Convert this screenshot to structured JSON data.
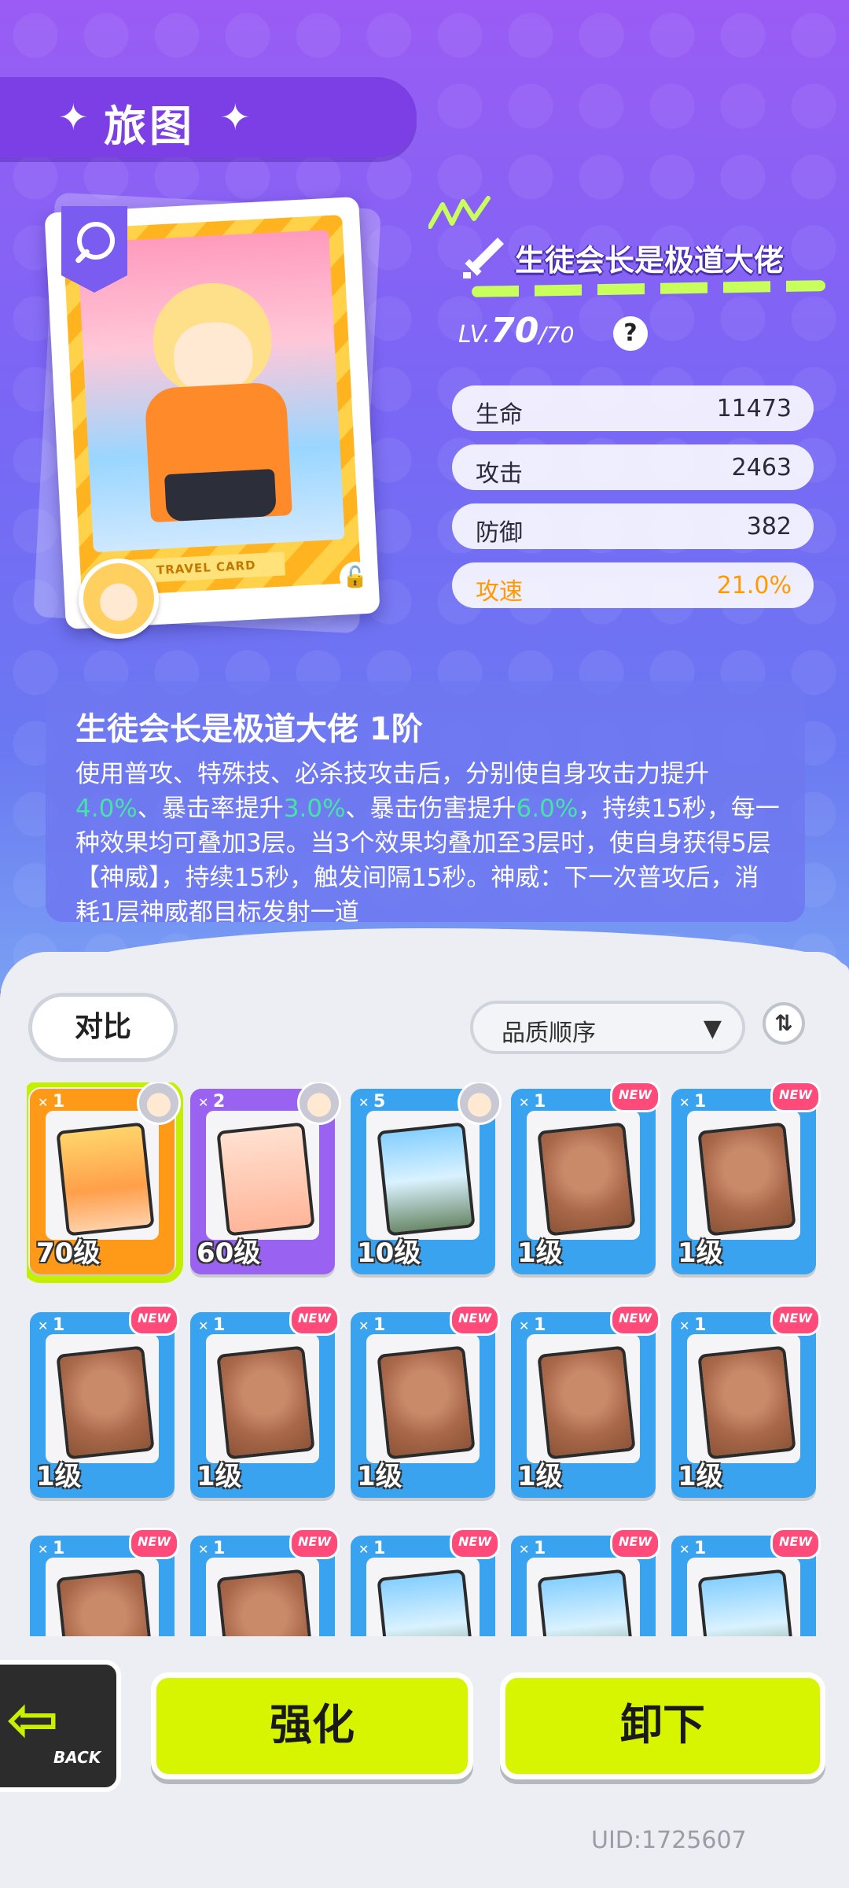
{
  "header": {
    "title": "旅图"
  },
  "card": {
    "label": "TRAVEL CARD",
    "name": "生徒会长是极道大佬",
    "level_prefix": "LV.",
    "level_current": "70",
    "level_max": "/70",
    "stats": [
      {
        "label": "生命",
        "value": "11473",
        "highlight": false
      },
      {
        "label": "攻击",
        "value": "2463",
        "highlight": false
      },
      {
        "label": "防御",
        "value": "382",
        "highlight": false
      },
      {
        "label": "攻速",
        "value": "21.0%",
        "highlight": true
      }
    ]
  },
  "skill": {
    "title": "生徒会长是极道大佬 1阶",
    "desc_parts": [
      {
        "text": "使用普攻、特殊技、必杀技攻击后，分别使自身攻击力提升",
        "green": false
      },
      {
        "text": "4.0%",
        "green": true
      },
      {
        "text": "、暴击率提升",
        "green": false
      },
      {
        "text": "3.0%",
        "green": true
      },
      {
        "text": "、暴击伤害提升",
        "green": false
      },
      {
        "text": "6.0%",
        "green": true
      },
      {
        "text": "，持续15秒，每一种效果均可叠加3层。当3个效果均叠加至3层时，使自身获得5层【神威】，持续15秒，触发间隔15秒。神威：下一次普攻后，消耗1层神威都目标发射一道",
        "green": false
      }
    ]
  },
  "controls": {
    "compare_label": "对比",
    "sort_label": "品质顺序",
    "sort_toggle": "⇅"
  },
  "grid": [
    {
      "count": "1",
      "level": "70级",
      "color": "orange",
      "pic": "girl",
      "new": false,
      "owner": true,
      "selected": true
    },
    {
      "count": "2",
      "level": "60级",
      "color": "purple",
      "pic": "food",
      "new": false,
      "owner": true,
      "selected": false
    },
    {
      "count": "5",
      "level": "10级",
      "color": "blue",
      "pic": "motel",
      "new": false,
      "owner": true,
      "selected": false
    },
    {
      "count": "1",
      "level": "1级",
      "color": "blue",
      "pic": "sphinx",
      "new": true,
      "owner": false,
      "selected": false
    },
    {
      "count": "1",
      "level": "1级",
      "color": "blue",
      "pic": "sphinx",
      "new": true,
      "owner": false,
      "selected": false
    },
    {
      "count": "1",
      "level": "1级",
      "color": "blue",
      "pic": "sphinx",
      "new": true,
      "owner": false,
      "selected": false
    },
    {
      "count": "1",
      "level": "1级",
      "color": "blue",
      "pic": "sphinx",
      "new": true,
      "owner": false,
      "selected": false
    },
    {
      "count": "1",
      "level": "1级",
      "color": "blue",
      "pic": "sphinx",
      "new": true,
      "owner": false,
      "selected": false
    },
    {
      "count": "1",
      "level": "1级",
      "color": "blue",
      "pic": "sphinx",
      "new": true,
      "owner": false,
      "selected": false
    },
    {
      "count": "1",
      "level": "1级",
      "color": "blue",
      "pic": "sphinx",
      "new": true,
      "owner": false,
      "selected": false
    },
    {
      "count": "1",
      "level": "",
      "color": "blue",
      "pic": "sphinx",
      "new": true,
      "owner": false,
      "selected": false
    },
    {
      "count": "1",
      "level": "",
      "color": "blue",
      "pic": "sphinx",
      "new": true,
      "owner": false,
      "selected": false
    },
    {
      "count": "1",
      "level": "",
      "color": "blue",
      "pic": "motel",
      "new": true,
      "owner": false,
      "selected": false
    },
    {
      "count": "1",
      "level": "",
      "color": "blue",
      "pic": "motel",
      "new": true,
      "owner": false,
      "selected": false
    },
    {
      "count": "1",
      "level": "",
      "color": "blue",
      "pic": "motel",
      "new": true,
      "owner": false,
      "selected": false
    }
  ],
  "new_tag": "NEW",
  "actions": {
    "back_label": "BACK",
    "enhance_label": "强化",
    "unequip_label": "卸下"
  },
  "uid": "UID:1725607",
  "colors": {
    "accent_lime": "#d8f500",
    "header_purple": "#7c3fe6",
    "highlight_orange": "#ff9a00",
    "green_value": "#46e3a6"
  }
}
